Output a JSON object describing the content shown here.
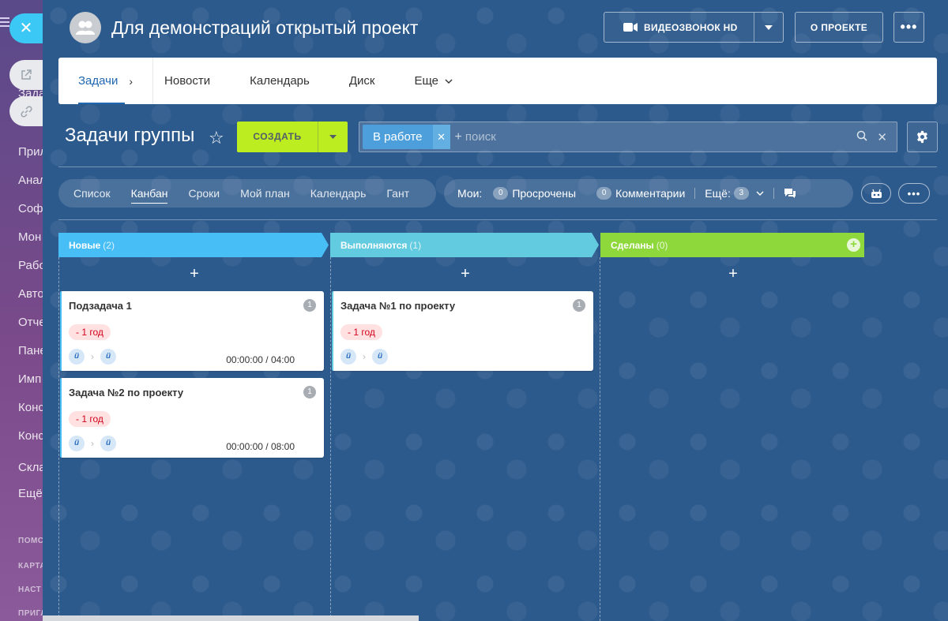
{
  "app_sidebar": {
    "items": [
      "Зада",
      "Прил",
      "Анал",
      "Соф",
      "Мон",
      "Рабо",
      "Авто",
      "Отче",
      "Пане",
      "Имп",
      "Конс",
      "Конс",
      "Скла",
      "Ещё"
    ],
    "small_items": [
      "ПОМС",
      "КАРТА",
      "НАСТ",
      "ПРИГЛ"
    ]
  },
  "header": {
    "title": "Для демонстраций открытый проект",
    "video_button": "ВИДЕОЗВОНОК HD",
    "about_button": "О ПРОЕКТЕ",
    "more_button": "•••"
  },
  "nav": {
    "tabs": [
      {
        "label": "Задачи"
      },
      {
        "label": "Новости"
      },
      {
        "label": "Календарь"
      },
      {
        "label": "Диск"
      },
      {
        "label": "Еще"
      }
    ]
  },
  "toolbar": {
    "title": "Задачи группы",
    "create_button": "СОЗДАТЬ",
    "filter_tag": "В работе",
    "search_placeholder": "поиск",
    "plus": "+"
  },
  "views": {
    "items": [
      "Список",
      "Канбан",
      "Сроки",
      "Мой план",
      "Календарь",
      "Гант"
    ],
    "active": "Канбан"
  },
  "counters": {
    "label": "Мои:",
    "overdue": {
      "count": "0",
      "label": "Просрочены"
    },
    "comments": {
      "count": "0",
      "label": "Комментарии"
    },
    "more": {
      "label": "Ещё:",
      "count": "3"
    }
  },
  "columns": [
    {
      "title": "Новые",
      "count": "(2)",
      "color": "#47bef5"
    },
    {
      "title": "Выполняются",
      "count": "(1)",
      "color": "#63cbe0"
    },
    {
      "title": "Сделаны",
      "count": "(0)",
      "color": "#8ed83b"
    }
  ],
  "cards": [
    {
      "title": "Подзадача 1",
      "badge": "1",
      "deadline": "- 1 год",
      "time": "00:00:00 / 04:00",
      "avatar": "ü"
    },
    {
      "title": "Задача №2 по проекту",
      "badge": "1",
      "deadline": "- 1 год",
      "time": "00:00:00 / 08:00",
      "avatar": "ü"
    },
    {
      "title": "Задача №1 по проекту",
      "badge": "1",
      "deadline": "- 1 год",
      "time": "",
      "avatar": "ü"
    }
  ],
  "colors": {
    "background": "#2d5a8c",
    "accent": "#2067b0",
    "create": "#bbed21",
    "overdue": "#d0021b"
  }
}
